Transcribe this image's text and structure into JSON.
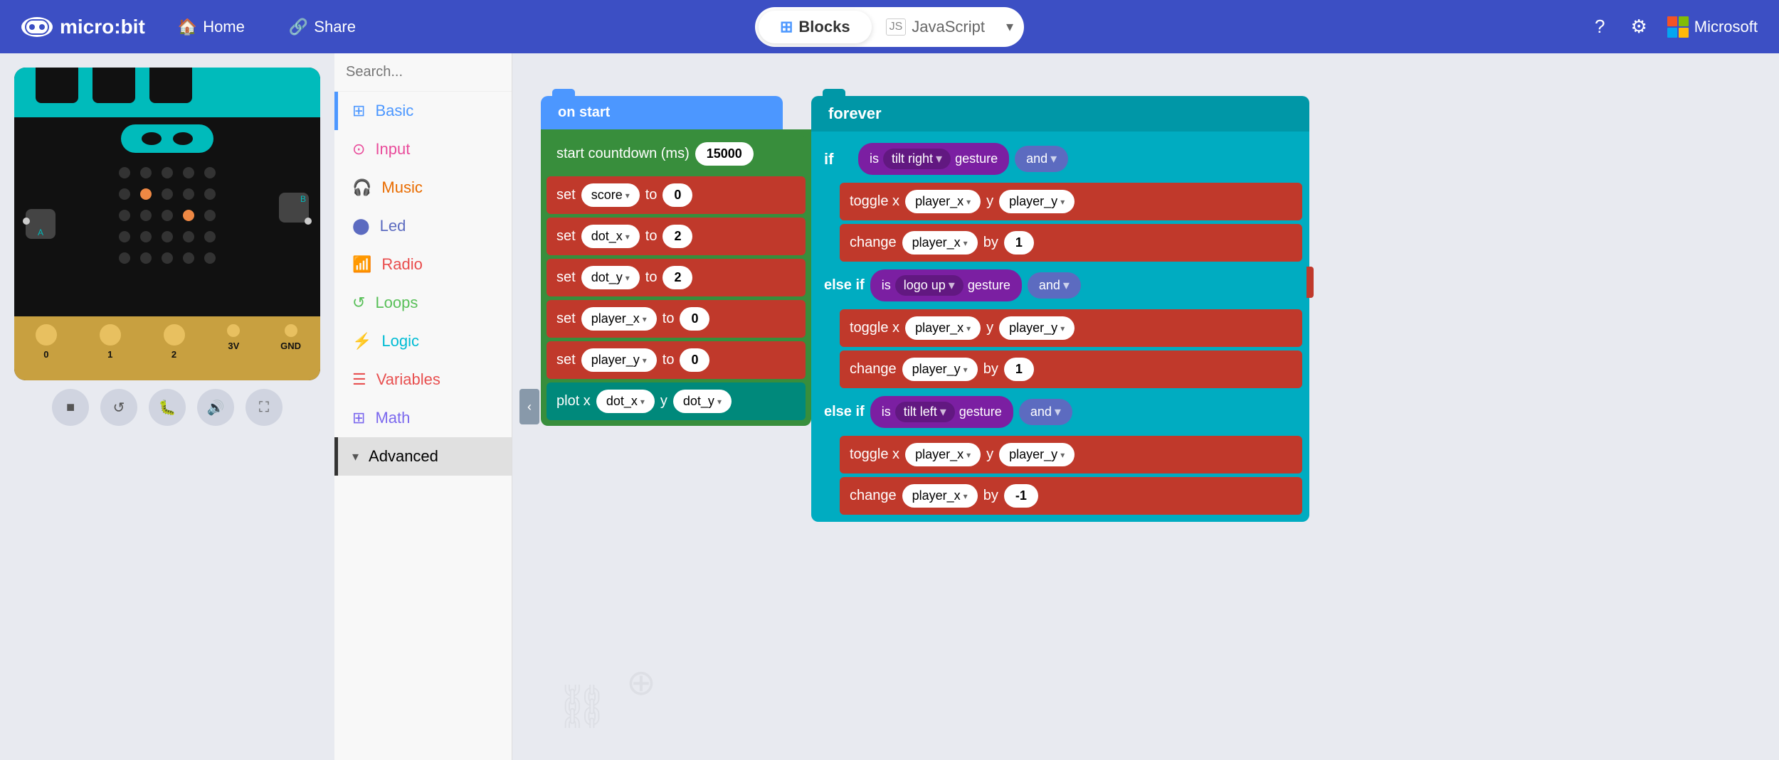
{
  "header": {
    "logo_text": "micro:bit",
    "home_label": "Home",
    "share_label": "Share",
    "blocks_label": "Blocks",
    "js_label": "JavaScript",
    "microsoft_label": "Microsoft"
  },
  "toolbox": {
    "search_placeholder": "Search...",
    "items": [
      {
        "label": "Basic",
        "color": "#4c97ff",
        "icon": "⊞"
      },
      {
        "label": "Input",
        "color": "#e94c9b",
        "icon": "⊙"
      },
      {
        "label": "Music",
        "color": "#e96c00",
        "icon": "🎧"
      },
      {
        "label": "Led",
        "color": "#5c6bc0",
        "icon": "⬤"
      },
      {
        "label": "Radio",
        "color": "#e94c4c",
        "icon": "📶"
      },
      {
        "label": "Loops",
        "color": "#59c059",
        "icon": "↺"
      },
      {
        "label": "Logic",
        "color": "#00bcd4",
        "icon": "⚔"
      },
      {
        "label": "Variables",
        "color": "#e85050",
        "icon": "☰"
      },
      {
        "label": "Math",
        "color": "#7b68ee",
        "icon": "⊞"
      },
      {
        "label": "Advanced",
        "color": "#333",
        "icon": "▾"
      }
    ]
  },
  "on_start": {
    "hat_label": "on start",
    "blocks": [
      {
        "type": "countdown",
        "label": "start countdown (ms)",
        "value": "15000"
      },
      {
        "type": "set",
        "label": "set",
        "var": "score",
        "to_label": "to",
        "value": "0"
      },
      {
        "type": "set",
        "label": "set",
        "var": "dot_x",
        "to_label": "to",
        "value": "2"
      },
      {
        "type": "set",
        "label": "set",
        "var": "dot_y",
        "to_label": "to",
        "value": "2"
      },
      {
        "type": "set",
        "label": "set",
        "var": "player_x",
        "to_label": "to",
        "value": "0"
      },
      {
        "type": "set",
        "label": "set",
        "var": "player_y",
        "to_label": "to",
        "value": "0"
      },
      {
        "type": "plot",
        "label": "plot x",
        "x_var": "dot_x",
        "y_label": "y",
        "y_var": "dot_y"
      }
    ]
  },
  "forever": {
    "hat_label": "forever",
    "if_blocks": [
      {
        "keyword": "if",
        "condition_parts": [
          "is",
          "tilt right",
          "gesture"
        ],
        "connector": "and",
        "actions": [
          {
            "label": "toggle x",
            "x_var": "player_x",
            "y_label": "y",
            "y_var": "player_y"
          },
          {
            "label": "change",
            "var": "player_x",
            "by_label": "by",
            "value": "1"
          }
        ]
      },
      {
        "keyword": "else if",
        "condition_parts": [
          "is",
          "logo up",
          "gesture"
        ],
        "connector": "and",
        "actions": [
          {
            "label": "toggle x",
            "x_var": "player_x",
            "y_label": "y",
            "y_var": "player_y"
          },
          {
            "label": "change",
            "var": "player_y",
            "by_label": "by",
            "value": "1"
          }
        ]
      },
      {
        "keyword": "else if",
        "condition_parts": [
          "is",
          "tilt left",
          "gesture"
        ],
        "connector": "and",
        "actions": [
          {
            "label": "toggle x",
            "x_var": "player_x",
            "y_label": "y",
            "y_var": "player_y"
          },
          {
            "label": "change",
            "var": "player_x",
            "by_label": "by",
            "value": "-1"
          }
        ]
      }
    ]
  },
  "sim_controls": [
    {
      "icon": "■",
      "label": "stop"
    },
    {
      "icon": "↺",
      "label": "restart"
    },
    {
      "icon": "🐛",
      "label": "debug"
    },
    {
      "icon": "🔊",
      "label": "sound"
    },
    {
      "icon": "⛶",
      "label": "fullscreen"
    }
  ],
  "pins": [
    "0",
    "1",
    "2",
    "3V",
    "GND"
  ]
}
